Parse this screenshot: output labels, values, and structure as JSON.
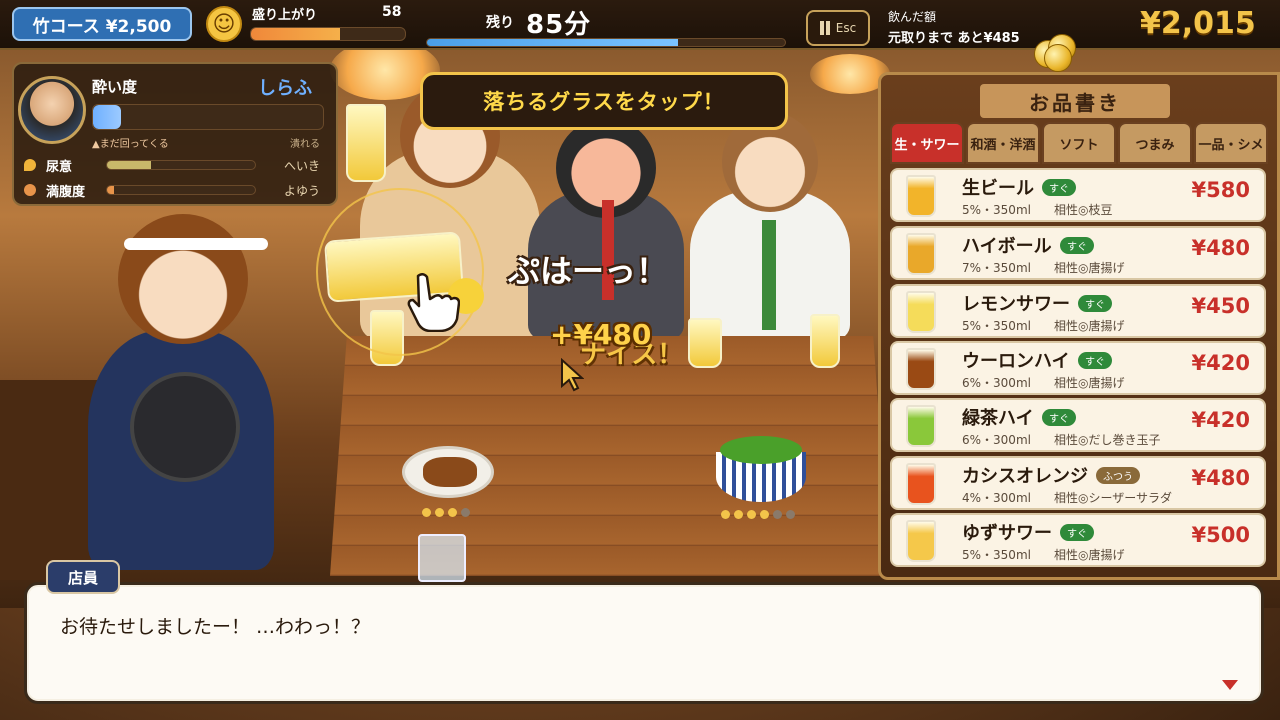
{
  "hud": {
    "course": "竹コース ¥2,500",
    "mood_label": "盛り上がり",
    "mood_value": "58",
    "mood_level": 0.58,
    "remain_label": "残り",
    "remain_value": "85分",
    "remain_level": 0.7,
    "esc_label": "Esc",
    "drank_label": "飲んだ額",
    "breakeven_text": "元取りまで あと¥485",
    "total": "¥2,015"
  },
  "status": {
    "drunk_label": "酔い度",
    "drunk_state": "しらふ",
    "drunk_level": 0.12,
    "drunk_note_low": "▲まだ回ってくる",
    "drunk_note_high": "潰れる",
    "stats": [
      {
        "label": "尿意",
        "value": "へいき",
        "level": 0.3
      },
      {
        "label": "満腹度",
        "value": "よゆう",
        "level": 0.05
      }
    ]
  },
  "callout": "落ちるグラスをタップ！",
  "scene": {
    "exclaim": "ぷはーっ！",
    "gain": "+¥480",
    "nice": "ナイス！",
    "karaage_dots": {
      "filled": 3,
      "total": 4
    },
    "edamame_dots": {
      "filled": 4,
      "total": 6
    }
  },
  "menu": {
    "title": "お品書き",
    "tabs": [
      "生・サワー",
      "和酒・洋酒",
      "ソフト",
      "つまみ",
      "一品・シメ"
    ],
    "active_tab": 0,
    "items": [
      {
        "name": "生ビール",
        "tag": "すぐ",
        "sub": "5%・350ml",
        "pair": "相性◎枝豆",
        "price": "¥580",
        "color": "#f2b42a"
      },
      {
        "name": "ハイボール",
        "tag": "すぐ",
        "sub": "7%・350ml",
        "pair": "相性◎唐揚げ",
        "price": "¥480",
        "color": "#e9a82a"
      },
      {
        "name": "レモンサワー",
        "tag": "すぐ",
        "sub": "5%・350ml",
        "pair": "相性◎唐揚げ",
        "price": "¥450",
        "color": "#f5dc5a"
      },
      {
        "name": "ウーロンハイ",
        "tag": "すぐ",
        "sub": "6%・300ml",
        "pair": "相性◎唐揚げ",
        "price": "¥420",
        "color": "#9a4a14"
      },
      {
        "name": "緑茶ハイ",
        "tag": "すぐ",
        "sub": "6%・300ml",
        "pair": "相性◎だし巻き玉子",
        "price": "¥420",
        "color": "#8ac83a"
      },
      {
        "name": "カシスオレンジ",
        "tag": "ふつう",
        "sub": "4%・300ml",
        "pair": "相性◎シーザーサラダ",
        "price": "¥480",
        "color": "#e8531e"
      },
      {
        "name": "ゆずサワー",
        "tag": "すぐ",
        "sub": "5%・350ml",
        "pair": "相性◎唐揚げ",
        "price": "¥500",
        "color": "#f5c84a"
      }
    ]
  },
  "dialog": {
    "speaker": "店員",
    "text": "お待たせしましたー！ …わわっ！？"
  }
}
